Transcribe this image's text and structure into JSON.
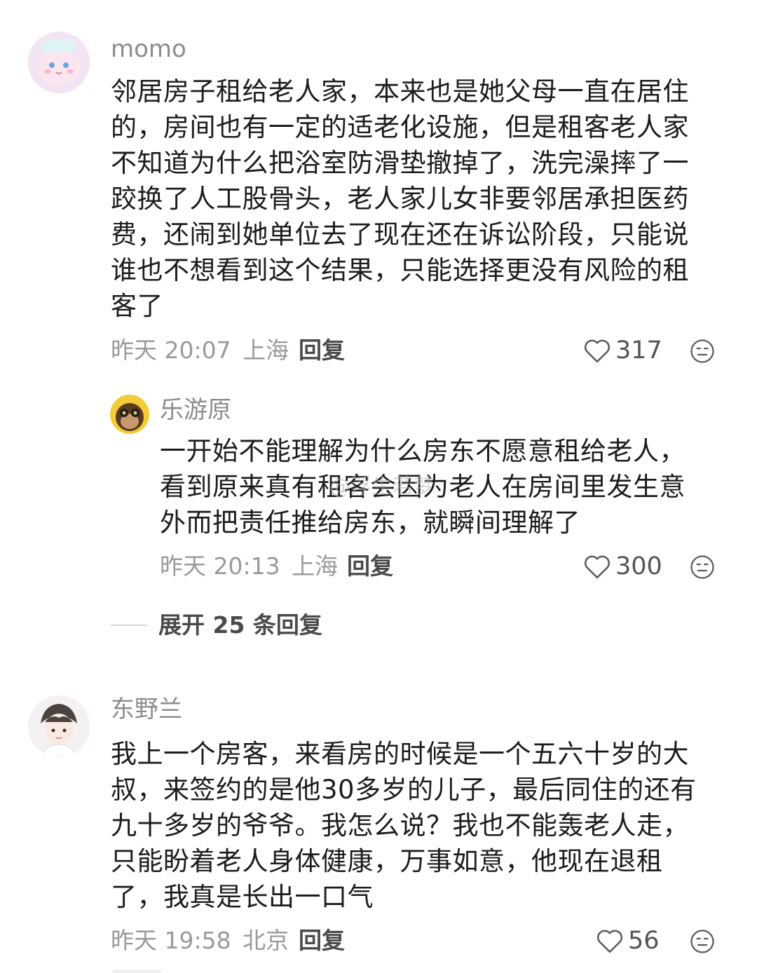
{
  "comments": [
    {
      "username": "momo",
      "avatar": "pink-cartoon-avatar",
      "content_lines": [
        "邻居房子租给老人家，本来也是她父母一直在居住",
        "的，房间也有一定的适老化设施，但是租客老人家",
        "不知道为什么把浴室防滑垫撤掉了，洗完澡摔了一",
        "跤换了人工股骨头，老人家儿女非要邻居承担医药",
        "费，还闹到她单位去了现在还在诉讼阶段，只能说",
        "谁也不想看到这个结果，只能选择更没有风险的租",
        "客了"
      ],
      "time": "昨天 20:07",
      "location": "上海",
      "reply_label": "回复",
      "likes": "317",
      "replies": [
        {
          "username": "乐游原",
          "avatar": "monkey-avatar",
          "content_lines": [
            "一开始不能理解为什么房东不愿意租给老人，",
            "看到原来真有租客会因为老人在房间里发生意",
            "外而把责任推给房东，就瞬间理解了"
          ],
          "time": "昨天 20:13",
          "location": "上海",
          "reply_label": "回复",
          "likes": "300"
        }
      ],
      "expand_label": "展开 25 条回复"
    },
    {
      "username": "东野兰",
      "avatar": "anime-boy-avatar",
      "content_lines": [
        "我上一个房客，来看房的时候是一个五六十岁的大",
        "叔，来签约的是他30多岁的儿子，最后同住的还有",
        "九十多岁的爷爷。我怎么说？我也不能轰老人走，",
        "只能盼着老人身体健康，万事如意，他现在退租",
        "了，我真是长出一口气"
      ],
      "time": "昨天 19:58",
      "location": "北京",
      "reply_label": "回复",
      "likes": "56"
    }
  ],
  "watermark": "@浮生若梦",
  "colors": {
    "text": "#1c1c1c",
    "meta": "#9a9a9a",
    "username": "#8c8c8c",
    "reply": "#4a4a4a"
  },
  "icons": {
    "like": "heart-outline-icon",
    "emoji": "neutral-face-icon"
  }
}
